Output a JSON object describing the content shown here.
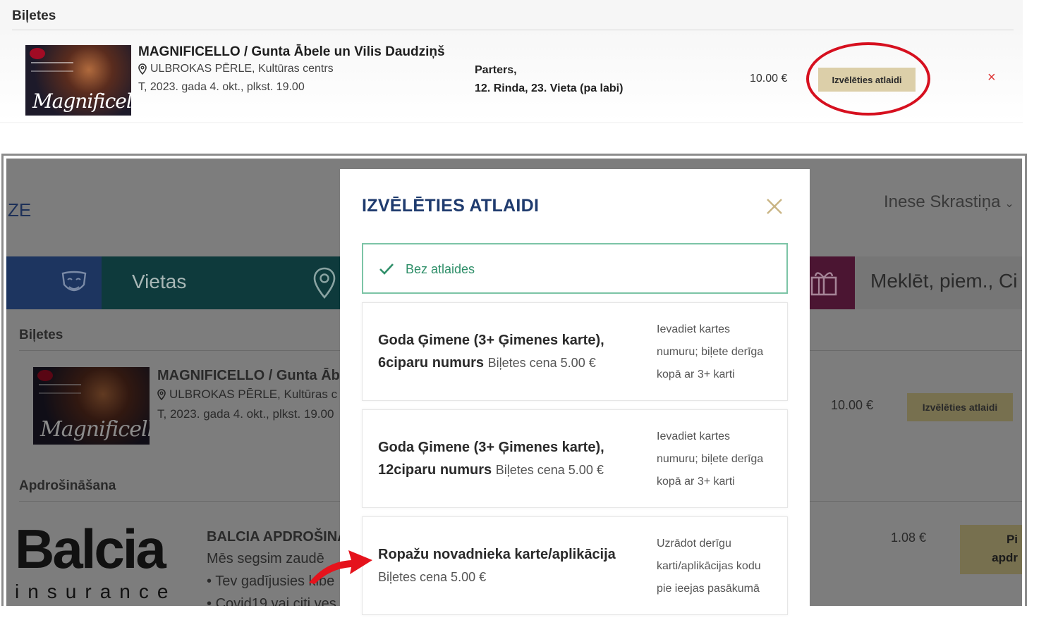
{
  "top": {
    "section_title": "Biļetes",
    "event": {
      "title": "MAGNIFICELLO / Gunta Ābele un Vilis Daudziņš",
      "venue": "ULBROKAS PĒRLE, Kultūras centrs",
      "date": "T, 2023. gada 4. okt., plkst. 19.00",
      "poster_text": "Magnificello"
    },
    "seat_line1": "Parters,",
    "seat_line2": "12. Rinda, 23. Vieta (pa labi)",
    "price": "10.00 €",
    "discount_button": "Izvēlēties atlaidi",
    "remove_symbol": "×",
    "highlight_color": "#d6101f"
  },
  "background": {
    "logo_fragment": "ZE",
    "user_name": "Inese Skrastiņa",
    "nav_places": "Vietas",
    "search_placeholder": "Meklēt, piem., Ci",
    "section_tickets": "Biļetes",
    "event_title": "MAGNIFICELLO / Gunta Āb",
    "event_venue": "ULBROKAS PĒRLE, Kultūras c",
    "event_date": "T, 2023. gada 4. okt., plkst. 19.00",
    "poster_text": "Magnificello",
    "price": "10.00 €",
    "discount_button": "Izvēlēties atlaidi",
    "section_insurance": "Apdrošināšana",
    "balcia_big": "Balcia",
    "balcia_small": "insurance",
    "insurance_title": "BALCIA APDROŠINĀ",
    "insurance_desc": "Mēs segsim zaudē",
    "insurance_bullet1": "Tev gadījusies kibe",
    "insurance_bullet2": "Covid19 vai citi ves",
    "insurance_price": "1.08 €",
    "insurance_btn_line1": "Pi",
    "insurance_btn_line2": "apdr"
  },
  "modal": {
    "title": "IZVĒLĒTIES ATLAIDI",
    "options": [
      {
        "label": "Bez atlaides",
        "selected": true
      },
      {
        "main_line1": "Goda Ģimene (3+ Ģimenes karte),",
        "main_line2": "6ciparu numurs",
        "price": "Biļetes cena 5.00 €",
        "note_line1": "Ievadiet kartes",
        "note_line2": "numuru; biļete derīga",
        "note_line3": "kopā ar 3+ karti"
      },
      {
        "main_line1": "Goda Ģimene (3+ Ģimenes karte),",
        "main_line2": "12ciparu numurs",
        "price": "Biļetes cena 5.00 €",
        "note_line1": "Ievadiet kartes",
        "note_line2": "numuru; biļete derīga",
        "note_line3": "kopā ar 3+ karti"
      },
      {
        "main_line1": "Ropažu novadnieka karte/aplikācija",
        "price": "Biļetes cena 5.00 €",
        "note_line1": "Uzrādot derīgu",
        "note_line2": "karti/aplikācijas kodu",
        "note_line3": "pie ieejas pasākumā"
      }
    ]
  },
  "colors": {
    "navy": "#1f3b6e",
    "green_check": "#2f8f69",
    "gold_button": "#dccfa9",
    "red_annotation": "#d6101f"
  }
}
